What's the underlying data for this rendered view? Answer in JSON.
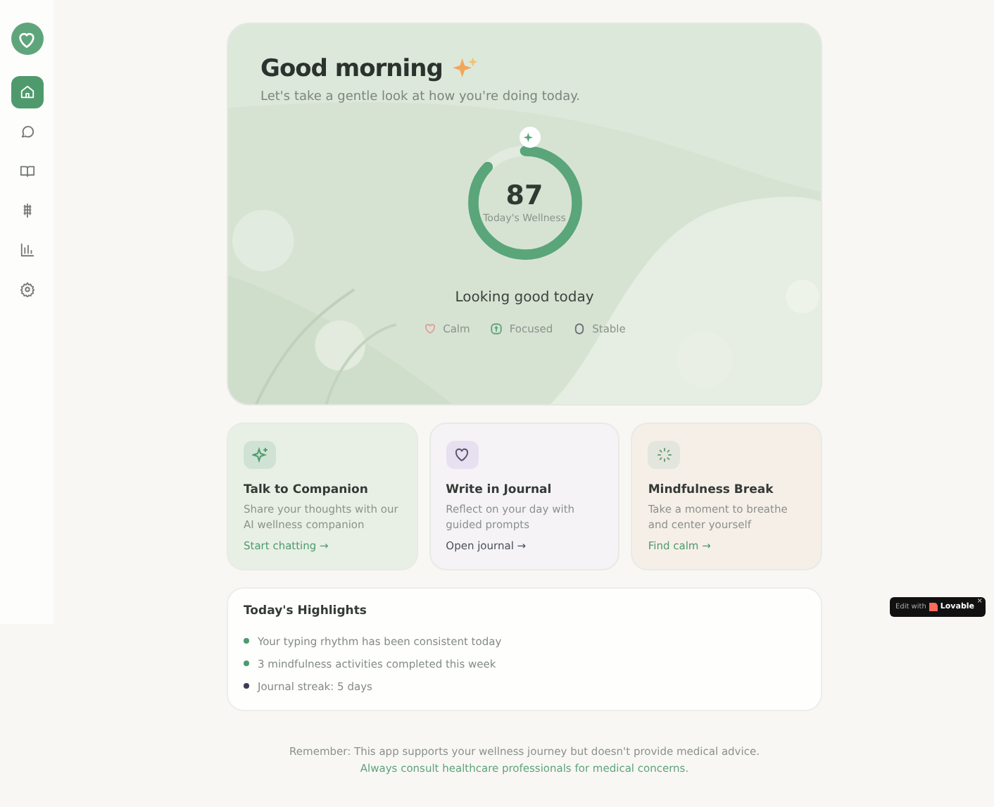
{
  "sidebar": {
    "logo": {
      "kind": "heart"
    },
    "items": [
      {
        "kind": "home",
        "selected": true
      },
      {
        "kind": "chat",
        "selected": false
      },
      {
        "kind": "book",
        "selected": false
      },
      {
        "kind": "sprout",
        "selected": false
      },
      {
        "kind": "chart",
        "selected": false
      },
      {
        "kind": "settings",
        "selected": false
      }
    ]
  },
  "hero": {
    "title": "Good morning",
    "subtitle": "Let's take a gentle look at how you're doing today.",
    "score": {
      "value": "87",
      "label": "Today's Wellness",
      "level": 0.87
    },
    "status": "Looking good today",
    "moods": [
      {
        "kind": "heart",
        "label": "Calm",
        "color": "#e0a39a"
      },
      {
        "kind": "brain",
        "label": "Focused",
        "color": "#5fa37a"
      },
      {
        "kind": "ring",
        "label": "Stable",
        "color": "#6b6f7a"
      }
    ]
  },
  "actions": [
    {
      "kind": "sparkle",
      "title": "Talk to Companion",
      "text": "Share your thoughts with our AI wellness companion",
      "link": "Start chatting →"
    },
    {
      "kind": "heart",
      "title": "Write in Journal",
      "text": "Reflect on your day with guided prompts",
      "link": "Open journal →"
    },
    {
      "kind": "loader",
      "title": "Mindfulness Break",
      "text": "Take a moment to breathe and center yourself",
      "link": "Find calm →"
    }
  ],
  "highlights": {
    "title": "Today's Highlights",
    "items": [
      {
        "text": "Your typing rhythm has been consistent today",
        "color": "#4e9a6e"
      },
      {
        "text": "3 mindfulness activities completed this week",
        "color": "#4e9a6e"
      },
      {
        "text": "Journal streak: 5 days",
        "color": "#3f3a55"
      }
    ]
  },
  "footer": {
    "note": "Remember: This app supports your wellness journey but doesn't provide medical advice.",
    "advice": "Always consult healthcare professionals for medical concerns."
  },
  "badge": {
    "prefix": "Edit with",
    "brand": "Lovable",
    "close": "×"
  }
}
